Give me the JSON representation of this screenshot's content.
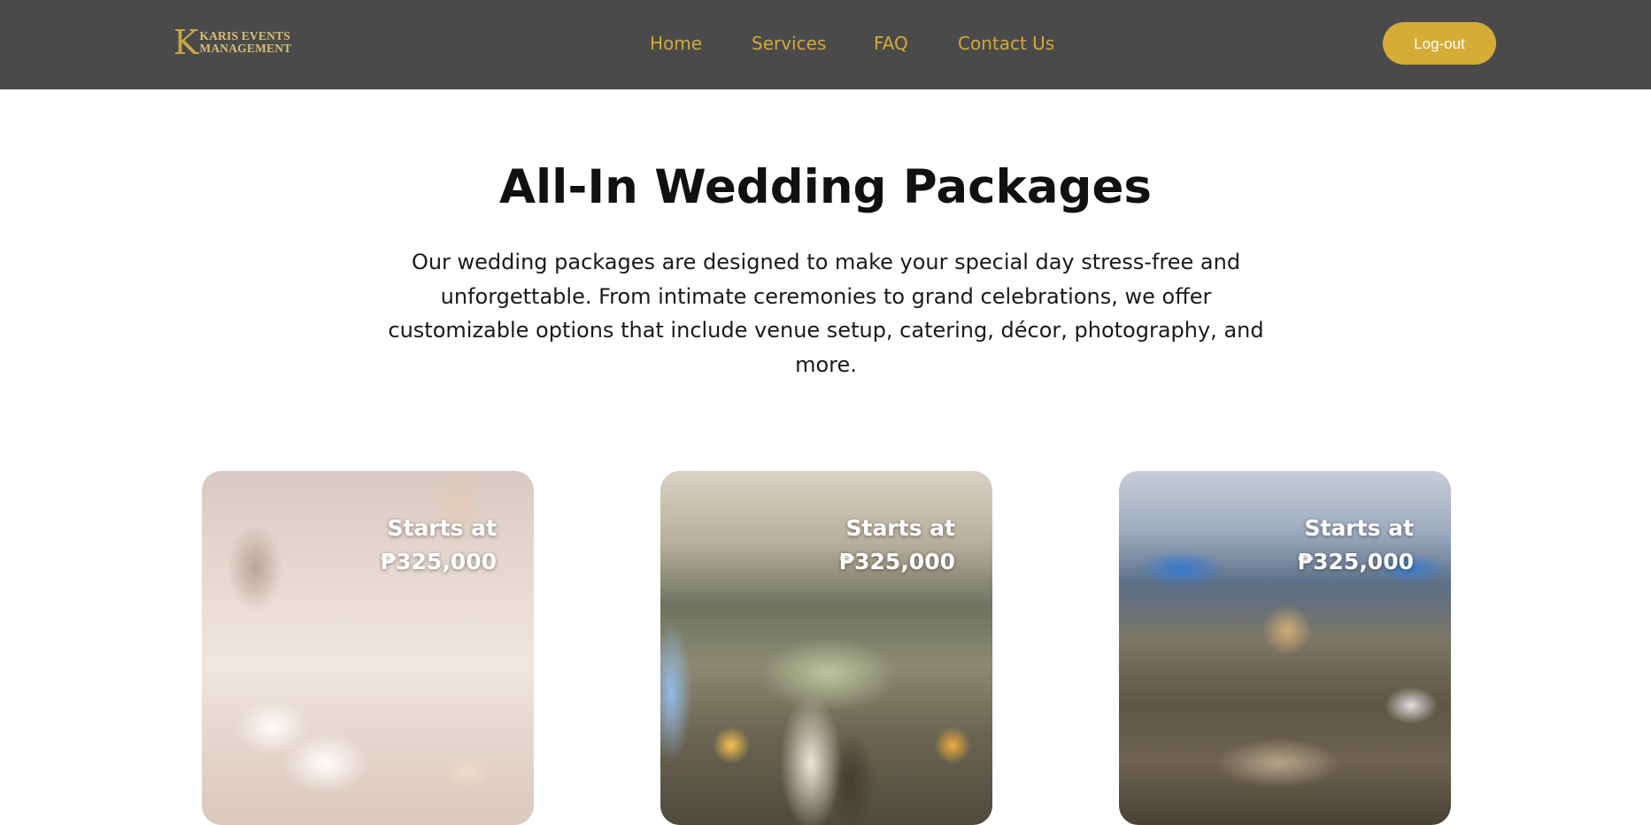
{
  "brand": {
    "logo_mark": "K",
    "logo_line1": "KARIS EVENTS",
    "logo_line2": "MANAGEMENT"
  },
  "nav": {
    "items": [
      {
        "label": "Home"
      },
      {
        "label": "Services"
      },
      {
        "label": "FAQ"
      },
      {
        "label": "Contact Us"
      }
    ],
    "logout_label": "Log-out"
  },
  "main": {
    "title": "All-In Wedding Packages",
    "description": "Our wedding packages are designed to make your special day stress-free and unforgettable. From intimate ceremonies to grand celebrations, we offer customizable options that include venue setup, catering, décor, photography, and more."
  },
  "packages": [
    {
      "price_line1": "Starts at",
      "price_line2": "₱325,000"
    },
    {
      "price_line1": "Starts at",
      "price_line2": "₱325,000"
    },
    {
      "price_line1": "Starts at",
      "price_line2": "₱325,000"
    }
  ],
  "colors": {
    "navbar_bg": "#4a4a4a",
    "accent_gold": "#d4ac36",
    "text_dark": "#111111"
  }
}
